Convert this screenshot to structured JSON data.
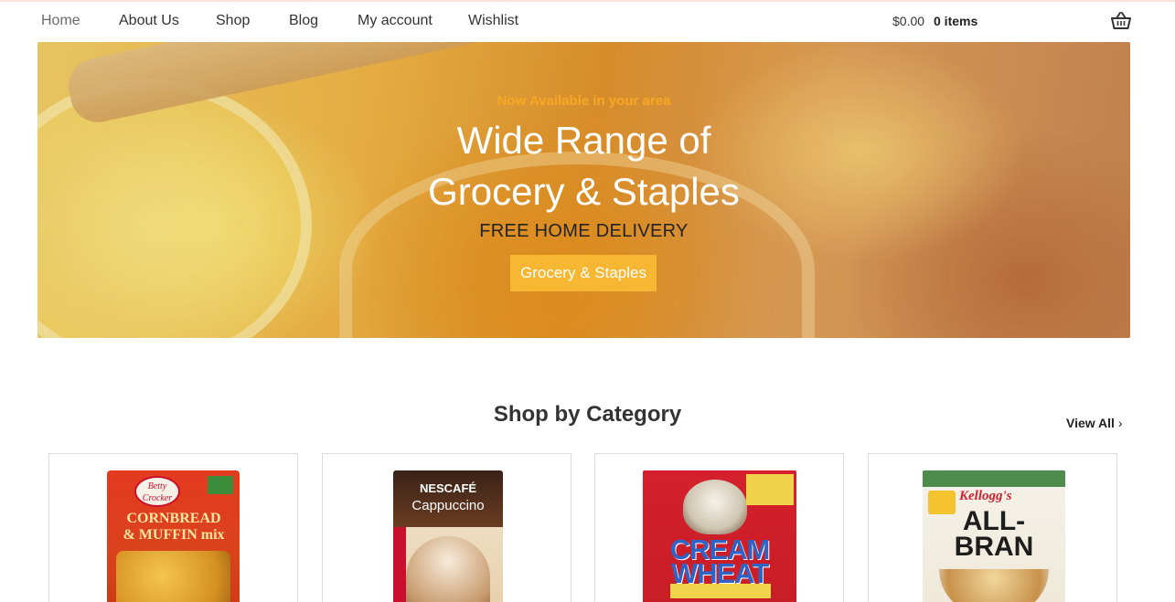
{
  "nav": {
    "items": [
      {
        "label": "Home",
        "active": true
      },
      {
        "label": "About Us"
      },
      {
        "label": "Shop"
      },
      {
        "label": "Blog"
      },
      {
        "label": "My account"
      },
      {
        "label": "Wishlist"
      }
    ],
    "cart_amount": "$0.00",
    "cart_items": "0 items",
    "cart_icon": "basket-icon"
  },
  "hero": {
    "subtitle": "Now Available in your area",
    "title_line1": "Wide Range of",
    "title_line2": "Grocery & Staples",
    "tagline": "FREE HOME DELIVERY",
    "button_label": "Grocery & Staples",
    "accent_color": "#f7b733"
  },
  "categories": {
    "title": "Shop by Category",
    "view_all": "View All",
    "products": [
      {
        "brand": "Betty Crocker",
        "name": "CORNBREAD & MUFFIN MIX"
      },
      {
        "brand": "NESCAFÉ",
        "name": "Cappuccino"
      },
      {
        "name": "CREAM OF WHEAT"
      },
      {
        "brand": "Kellogg's",
        "name": "ALL-BRAN"
      }
    ]
  }
}
